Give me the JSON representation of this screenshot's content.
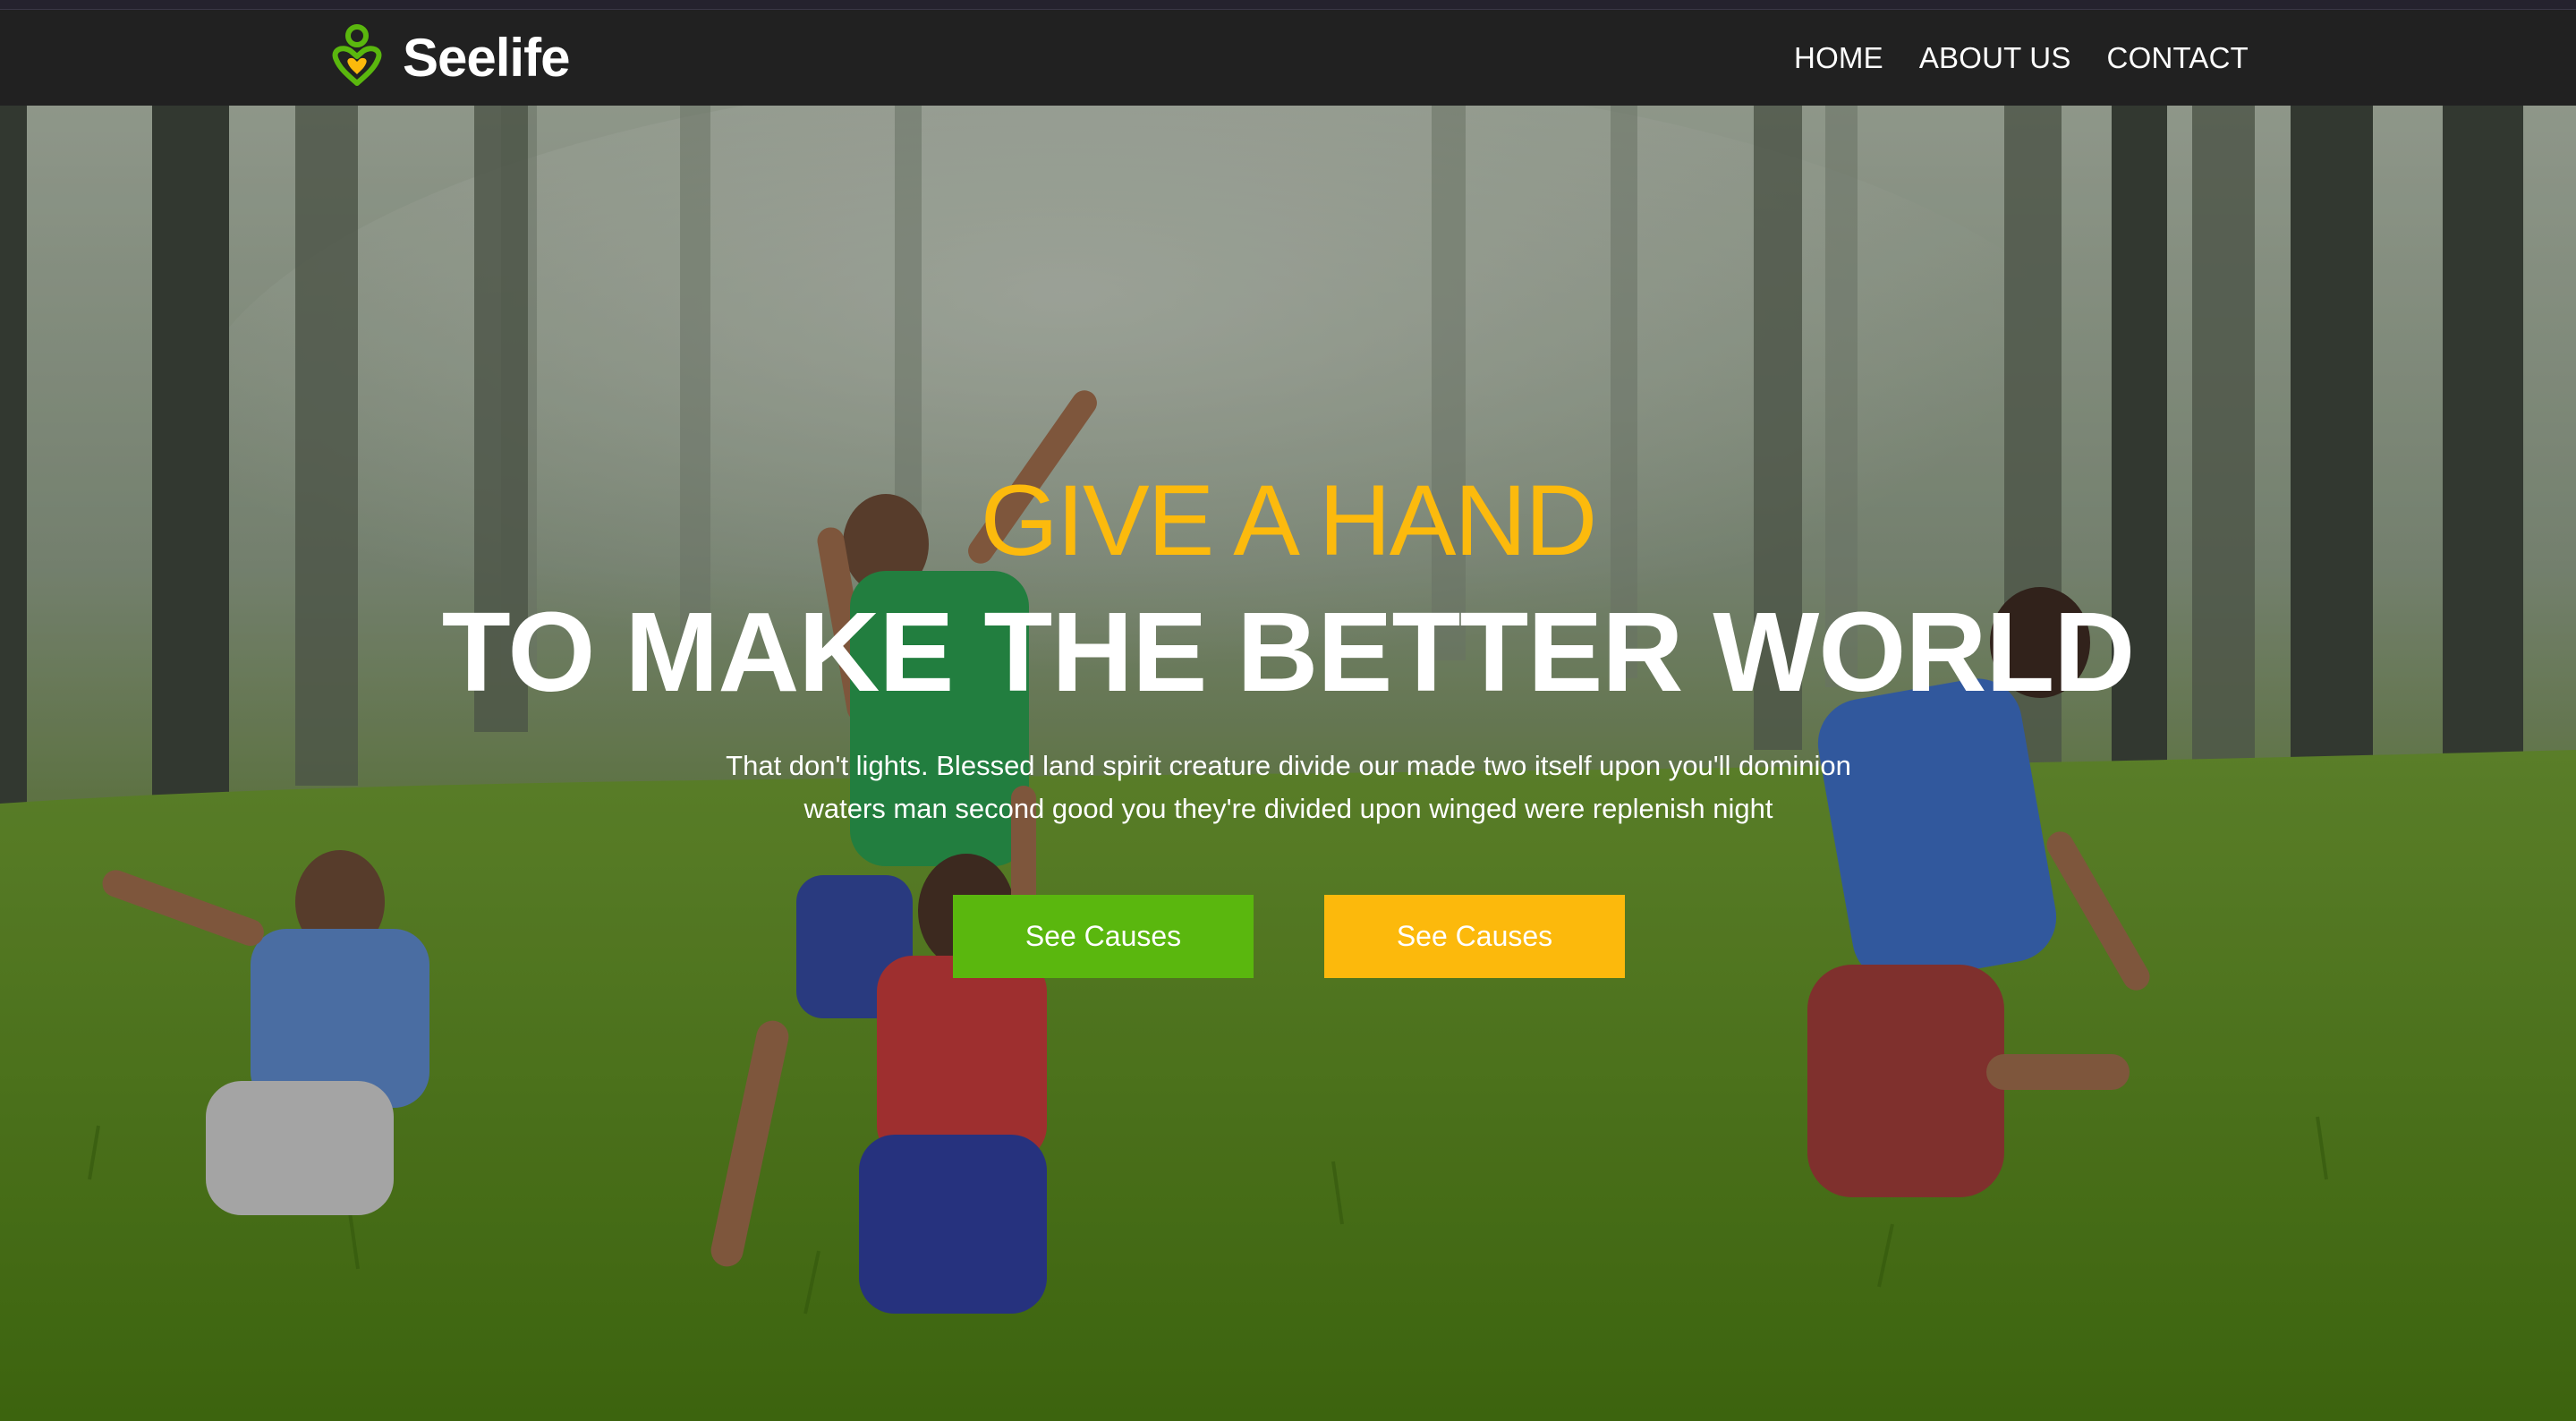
{
  "brand": {
    "name": "Seelife",
    "logo_icon": "heart-person-icon",
    "logo_colors": {
      "green": "#5ab70e",
      "yellow": "#fcb90c"
    }
  },
  "nav": {
    "items": [
      {
        "label": "HOME"
      },
      {
        "label": "ABOUT US"
      },
      {
        "label": "CONTACT"
      }
    ]
  },
  "hero": {
    "kicker": "GIVE A HAND",
    "headline": "TO MAKE THE BETTER WORLD",
    "description_line1": "That don't lights. Blessed land spirit creature divide our made two itself upon you'll dominion",
    "description_line2": "waters man second good you they're divided upon winged were replenish night",
    "primary_button": "See Causes",
    "secondary_button": "See Causes",
    "background_image": "children-jumping-in-forest-photo"
  },
  "colors": {
    "navbar": "#212121",
    "accent_yellow": "#fcba0d",
    "accent_green": "#5ab70e",
    "text": "#ffffff"
  }
}
